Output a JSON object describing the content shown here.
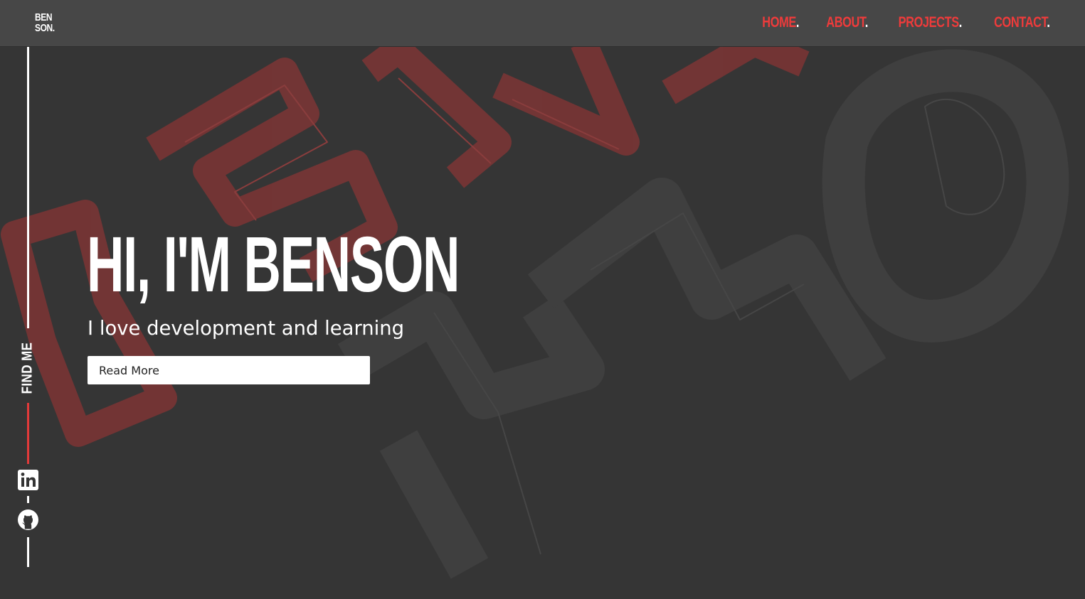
{
  "header": {
    "logo_line1": "BEN",
    "logo_line2": "SON.",
    "nav": [
      {
        "label": "HOME",
        "dot": "."
      },
      {
        "label": "ABOUT",
        "dot": "."
      },
      {
        "label": "PROJECTS",
        "dot": "."
      },
      {
        "label": "CONTACT",
        "dot": "."
      }
    ]
  },
  "sidebar": {
    "find_me": "FIND ME",
    "icons": [
      "linkedin-icon",
      "github-icon"
    ]
  },
  "hero": {
    "title": "HI, I'M BENSON",
    "subtitle": "I love development and learning",
    "button_label": "Read More"
  },
  "colors": {
    "background": "#353535",
    "header": "#474747",
    "accent": "#ee3b3b",
    "decor_red": "#763535",
    "decor_gray": "#404040",
    "text": "#ffffff"
  }
}
